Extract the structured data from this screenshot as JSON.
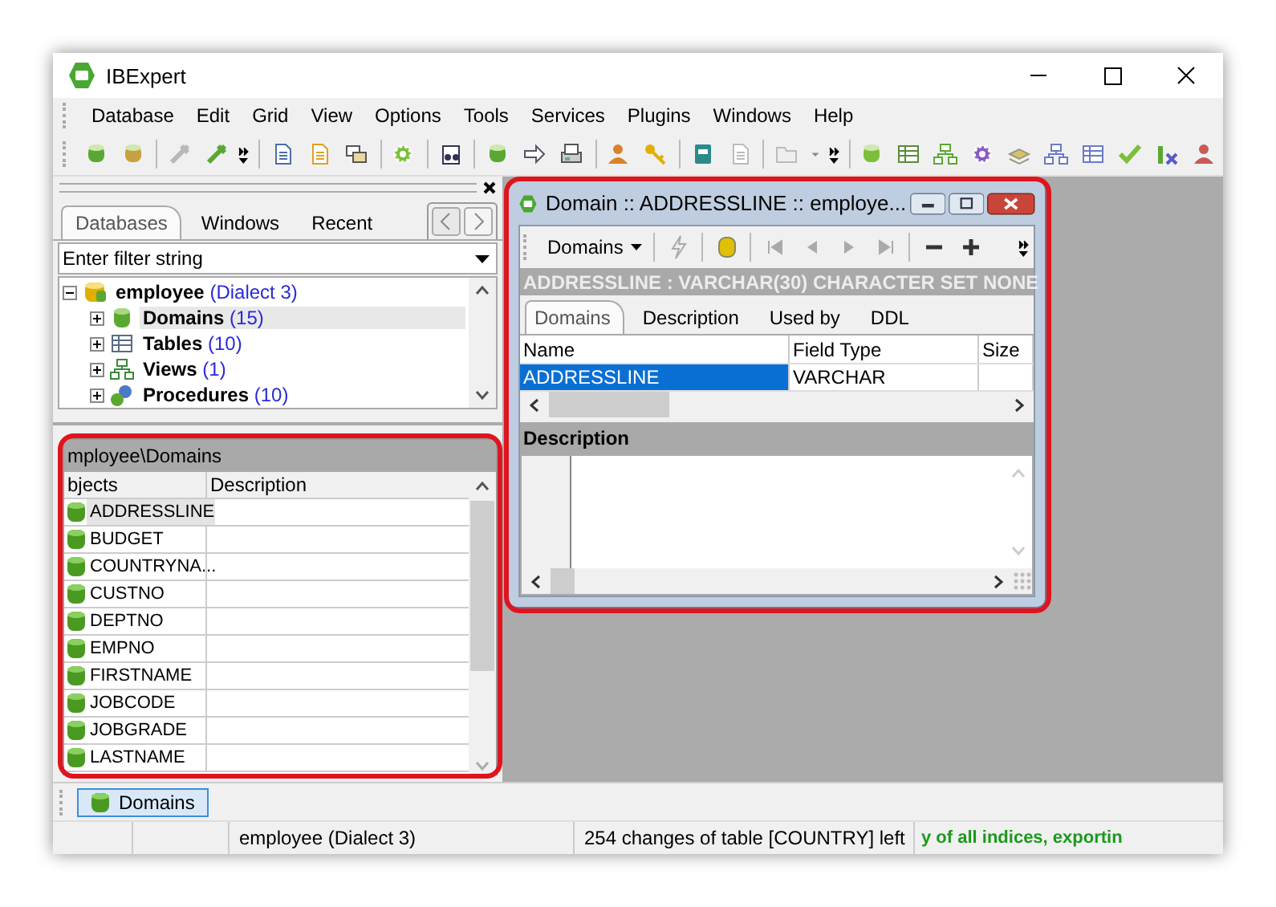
{
  "window": {
    "title": "IBExpert"
  },
  "menu": [
    "Database",
    "Edit",
    "Grid",
    "View",
    "Options",
    "Tools",
    "Services",
    "Plugins",
    "Windows",
    "Help"
  ],
  "db_explorer": {
    "tabs": [
      {
        "label": "Databases",
        "selected": true
      },
      {
        "label": "Windows",
        "selected": false
      },
      {
        "label": "Recent",
        "selected": false
      }
    ],
    "filter": {
      "placeholder": "Enter filter string"
    },
    "tree": [
      {
        "label": "employee",
        "count": "(Dialect 3)",
        "kind": "database",
        "expanded": true,
        "selected": false,
        "children": [
          {
            "label": "Domains",
            "count": "(15)",
            "kind": "domain",
            "expanded": false,
            "selected": true
          },
          {
            "label": "Tables",
            "count": "(10)",
            "kind": "table",
            "expanded": false,
            "selected": false
          },
          {
            "label": "Views",
            "count": "(1)",
            "kind": "view",
            "expanded": false,
            "selected": false
          },
          {
            "label": "Procedures",
            "count": "(10)",
            "kind": "procedure",
            "expanded": false,
            "selected": false
          }
        ]
      }
    ]
  },
  "object_list": {
    "path": "mployee\\Domains",
    "columns": [
      "bjects",
      "Description"
    ],
    "rows": [
      {
        "name": "ADDRESSLINE",
        "selected": true
      },
      {
        "name": "BUDGET",
        "selected": false
      },
      {
        "name": "COUNTRYNA...",
        "selected": false
      },
      {
        "name": "CUSTNO",
        "selected": false
      },
      {
        "name": "DEPTNO",
        "selected": false
      },
      {
        "name": "EMPNO",
        "selected": false
      },
      {
        "name": "FIRSTNAME",
        "selected": false
      },
      {
        "name": "JOBCODE",
        "selected": false
      },
      {
        "name": "JOBGRADE",
        "selected": false
      },
      {
        "name": "LASTNAME",
        "selected": false
      }
    ]
  },
  "child_window": {
    "title": "Domain :: ADDRESSLINE :: employe...",
    "menu_button": "Domains",
    "header": "ADDRESSLINE : VARCHAR(30) CHARACTER SET NONE",
    "tabs": [
      {
        "label": "Domains",
        "selected": true
      },
      {
        "label": "Description",
        "selected": false
      },
      {
        "label": "Used by",
        "selected": false
      },
      {
        "label": "DDL",
        "selected": false
      }
    ],
    "columns": [
      "Name",
      "Field Type",
      "Size"
    ],
    "rows": [
      {
        "name": "ADDRESSLINE",
        "type": "VARCHAR",
        "selected": true
      }
    ],
    "description_heading": "Description"
  },
  "taskbar": [
    {
      "label": "Domains",
      "selected": true
    }
  ],
  "status_bar": [
    {
      "text": "employee (Dialect 3)",
      "kind": "plain"
    },
    {
      "text": "254 changes of table [COUNTRY] left",
      "kind": "plain"
    },
    {
      "text": "y of all indices, exportin",
      "kind": "progress"
    }
  ]
}
